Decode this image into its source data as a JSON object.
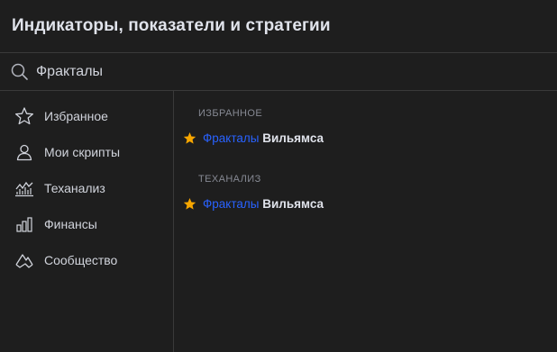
{
  "dialog": {
    "title": "Индикаторы, показатели и стратегии"
  },
  "search": {
    "value": "Фракталы",
    "placeholder": ""
  },
  "sidebar": {
    "items": [
      {
        "label": "Избранное",
        "icon": "star-outline-icon"
      },
      {
        "label": "Мои скрипты",
        "icon": "user-icon"
      },
      {
        "label": "Теханализ",
        "icon": "technical-analysis-icon"
      },
      {
        "label": "Финансы",
        "icon": "bar-chart-icon"
      },
      {
        "label": "Сообщество",
        "icon": "community-scripts-icon"
      }
    ]
  },
  "results": {
    "sections": [
      {
        "header": "ИЗБРАННОЕ",
        "items": [
          {
            "match": "Фракталы",
            "rest": "Вильямса",
            "favorite": true
          }
        ]
      },
      {
        "header": "ТЕХАНАЛИЗ",
        "items": [
          {
            "match": "Фракталы",
            "rest": "Вильямса",
            "favorite": true
          }
        ]
      }
    ]
  },
  "colors": {
    "background": "#1e1e1e",
    "highlight": "#2962ff",
    "star": "#f7a600",
    "border": "#3a3a3a"
  }
}
